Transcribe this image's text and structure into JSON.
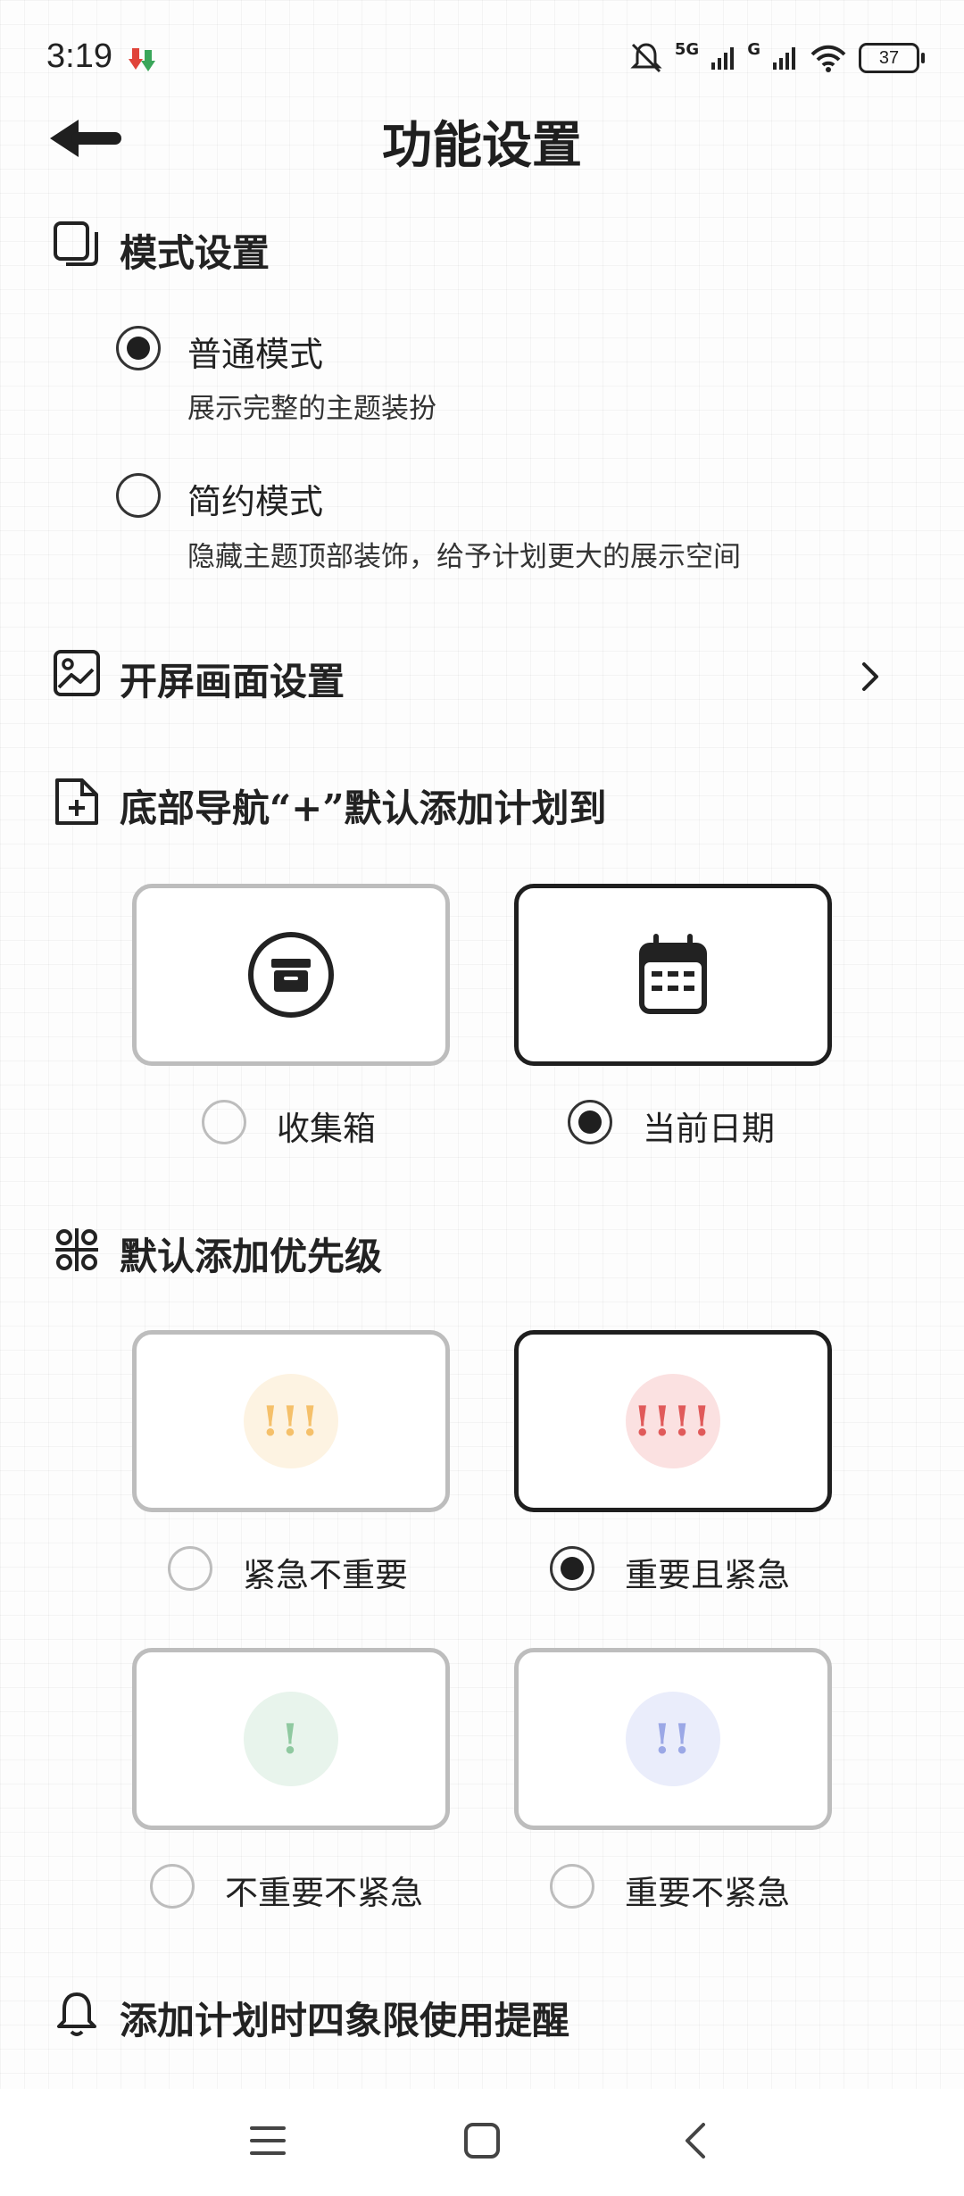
{
  "status": {
    "time": "3:19",
    "battery": "37",
    "net1": "5G",
    "net2": "G"
  },
  "header": {
    "title": "功能设置"
  },
  "mode": {
    "title": "模式设置",
    "options": [
      {
        "label": "普通模式",
        "desc": "展示完整的主题装扮",
        "selected": true
      },
      {
        "label": "简约模式",
        "desc": "隐藏主题顶部装饰，给予计划更大的展示空间",
        "selected": false
      }
    ]
  },
  "splash": {
    "title": "开屏画面设置"
  },
  "nav_add": {
    "title": "底部导航“+”默认添加计划到",
    "options": [
      {
        "label": "收集箱",
        "icon": "inbox-icon",
        "selected": false
      },
      {
        "label": "当前日期",
        "icon": "calendar-icon",
        "selected": true
      }
    ]
  },
  "priority": {
    "title": "默认添加优先级",
    "options": [
      {
        "label": "紧急不重要",
        "mark": "!!!",
        "color": "#f5c06a",
        "bg": "#fdf3e2",
        "selected": false
      },
      {
        "label": "重要且紧急",
        "mark": "!!!!",
        "color": "#e05a5a",
        "bg": "#fbe1e1",
        "selected": true
      },
      {
        "label": "不重要不紧急",
        "mark": "!",
        "color": "#8fc9a0",
        "bg": "#e8f4ec",
        "selected": false
      },
      {
        "label": "重要不紧急",
        "mark": "!!",
        "color": "#9ba8e6",
        "bg": "#eaedfb",
        "selected": false
      }
    ]
  },
  "reminder": {
    "title": "添加计划时四象限使用提醒"
  }
}
